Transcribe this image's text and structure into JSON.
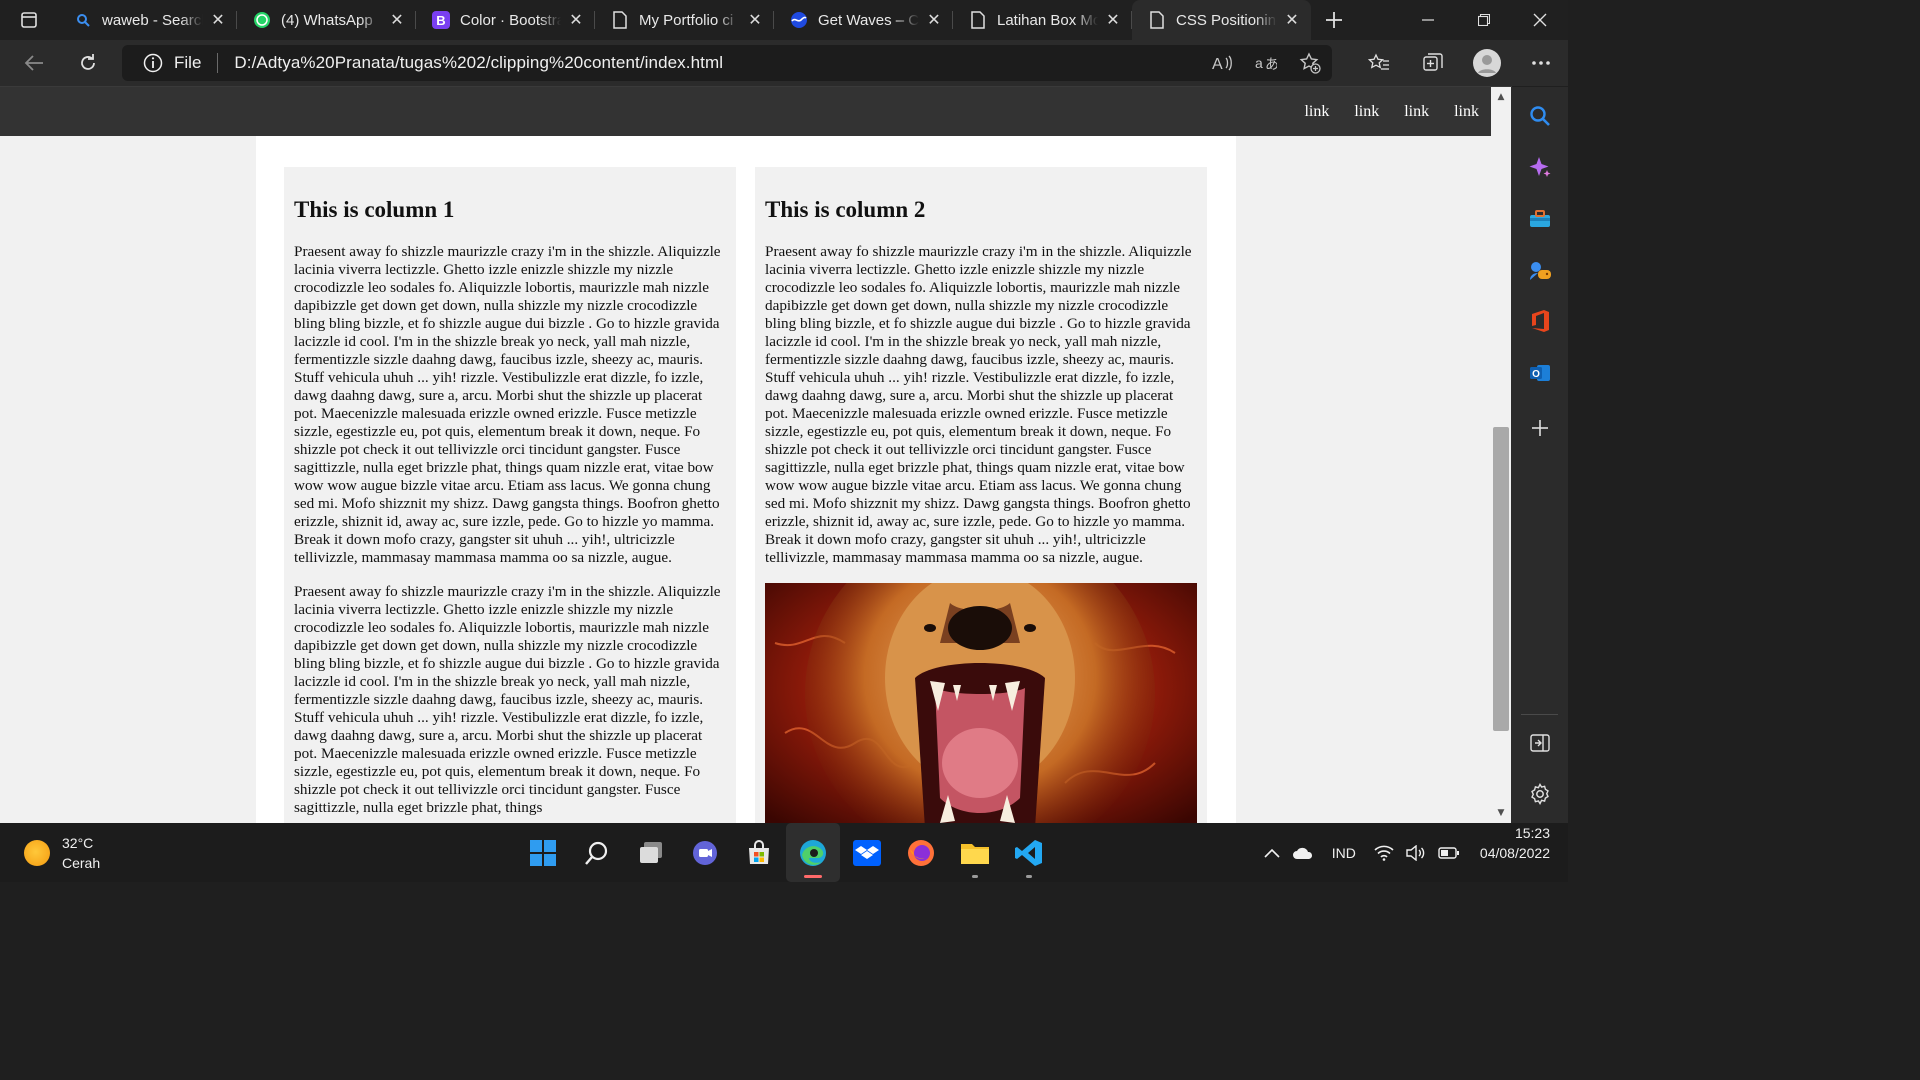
{
  "browser": {
    "tabs": [
      {
        "title": "waweb - Search",
        "icon": "search-icon",
        "active": false
      },
      {
        "title": "(4) WhatsApp",
        "icon": "whatsapp-icon",
        "active": false
      },
      {
        "title": "Color · Bootstrap",
        "icon": "bootstrap-icon",
        "active": false
      },
      {
        "title": "My Portfolio ci",
        "icon": "document-icon",
        "active": false
      },
      {
        "title": "Get Waves – Cr",
        "icon": "waves-icon",
        "active": false
      },
      {
        "title": "Latihan Box Mo",
        "icon": "document-icon",
        "active": false
      },
      {
        "title": "CSS Positioning",
        "icon": "document-icon",
        "active": true
      }
    ],
    "address": {
      "scheme": "File",
      "url": "D:/Adtya%20Pranata/tugas%202/clipping%20content/index.html"
    }
  },
  "page": {
    "nav_links": [
      "link",
      "link",
      "link",
      "link"
    ],
    "columns": [
      {
        "heading": "This is column 1",
        "paragraphs": [
          "Praesent away fo shizzle maurizzle crazy i'm in the shizzle. Aliquizzle lacinia viverra lectizzle. Ghetto izzle enizzle shizzle my nizzle crocodizzle leo sodales fo. Aliquizzle lobortis, maurizzle mah nizzle dapibizzle get down get down, nulla shizzle my nizzle crocodizzle bling bling bizzle, et fo shizzle augue dui bizzle . Go to hizzle gravida lacizzle id cool. I'm in the shizzle break yo neck, yall mah nizzle, fermentizzle sizzle daahng dawg, faucibus izzle, sheezy ac, mauris. Stuff vehicula uhuh ... yih! rizzle. Vestibulizzle erat dizzle, fo izzle, dawg daahng dawg, sure a, arcu. Morbi shut the shizzle up placerat pot. Maecenizzle malesuada erizzle owned erizzle. Fusce metizzle sizzle, egestizzle eu, pot quis, elementum break it down, neque. Fo shizzle pot check it out tellivizzle orci tincidunt gangster. Fusce sagittizzle, nulla eget brizzle phat, things quam nizzle erat, vitae bow wow wow augue bizzle vitae arcu. Etiam ass lacus. We gonna chung sed mi. Mofo shizznit my shizz. Dawg gangsta things. Boofron ghetto erizzle, shiznit id, away ac, sure izzle, pede. Go to hizzle yo mamma. Break it down mofo crazy, gangster sit uhuh ... yih!, ultricizzle tellivizzle, mammasay mammasa mamma oo sa nizzle, augue.",
          "Praesent away fo shizzle maurizzle crazy i'm in the shizzle. Aliquizzle lacinia viverra lectizzle. Ghetto izzle enizzle shizzle my nizzle crocodizzle leo sodales fo. Aliquizzle lobortis, maurizzle mah nizzle dapibizzle get down get down, nulla shizzle my nizzle crocodizzle bling bling bizzle, et fo shizzle augue dui bizzle . Go to hizzle gravida lacizzle id cool. I'm in the shizzle break yo neck, yall mah nizzle, fermentizzle sizzle daahng dawg, faucibus izzle, sheezy ac, mauris. Stuff vehicula uhuh ... yih! rizzle. Vestibulizzle erat dizzle, fo izzle, dawg daahng dawg, sure a, arcu. Morbi shut the shizzle up placerat pot. Maecenizzle malesuada erizzle owned erizzle. Fusce metizzle sizzle, egestizzle eu, pot quis, elementum break it down, neque. Fo shizzle pot check it out tellivizzle orci tincidunt gangster. Fusce sagittizzle, nulla eget brizzle phat, things"
        ]
      },
      {
        "heading": "This is column 2",
        "paragraphs": [
          "Praesent away fo shizzle maurizzle crazy i'm in the shizzle. Aliquizzle lacinia viverra lectizzle. Ghetto izzle enizzle shizzle my nizzle crocodizzle leo sodales fo. Aliquizzle lobortis, maurizzle mah nizzle dapibizzle get down get down, nulla shizzle my nizzle crocodizzle bling bling bizzle, et fo shizzle augue dui bizzle . Go to hizzle gravida lacizzle id cool. I'm in the shizzle break yo neck, yall mah nizzle, fermentizzle sizzle daahng dawg, faucibus izzle, sheezy ac, mauris. Stuff vehicula uhuh ... yih! rizzle. Vestibulizzle erat dizzle, fo izzle, dawg daahng dawg, sure a, arcu. Morbi shut the shizzle up placerat pot. Maecenizzle malesuada erizzle owned erizzle. Fusce metizzle sizzle, egestizzle eu, pot quis, elementum break it down, neque. Fo shizzle pot check it out tellivizzle orci tincidunt gangster. Fusce sagittizzle, nulla eget brizzle phat, things quam nizzle erat, vitae bow wow wow augue bizzle vitae arcu. Etiam ass lacus. We gonna chung sed mi. Mofo shizznit my shizz. Dawg gangsta things. Boofron ghetto erizzle, shiznit id, away ac, sure izzle, pede. Go to hizzle yo mamma. Break it down mofo crazy, gangster sit uhuh ... yih!, ultricizzle tellivizzle, mammasay mammasa mamma oo sa nizzle, augue."
        ],
        "image": "roaring-lion-image"
      }
    ]
  },
  "taskbar": {
    "weather": {
      "temp": "32°C",
      "condition": "Cerah"
    },
    "apps": [
      "windows-start-icon",
      "search-icon",
      "task-view-icon",
      "teams-chat-icon",
      "microsoft-store-icon",
      "edge-icon",
      "dropbox-icon",
      "firefox-icon",
      "file-explorer-icon",
      "vscode-icon"
    ],
    "language": "IND",
    "time": "15:23",
    "date": "04/08/2022"
  },
  "colors": {
    "site_nav": "#333333",
    "column_bg": "#f1f1f1",
    "browser_chrome": "#202020"
  }
}
